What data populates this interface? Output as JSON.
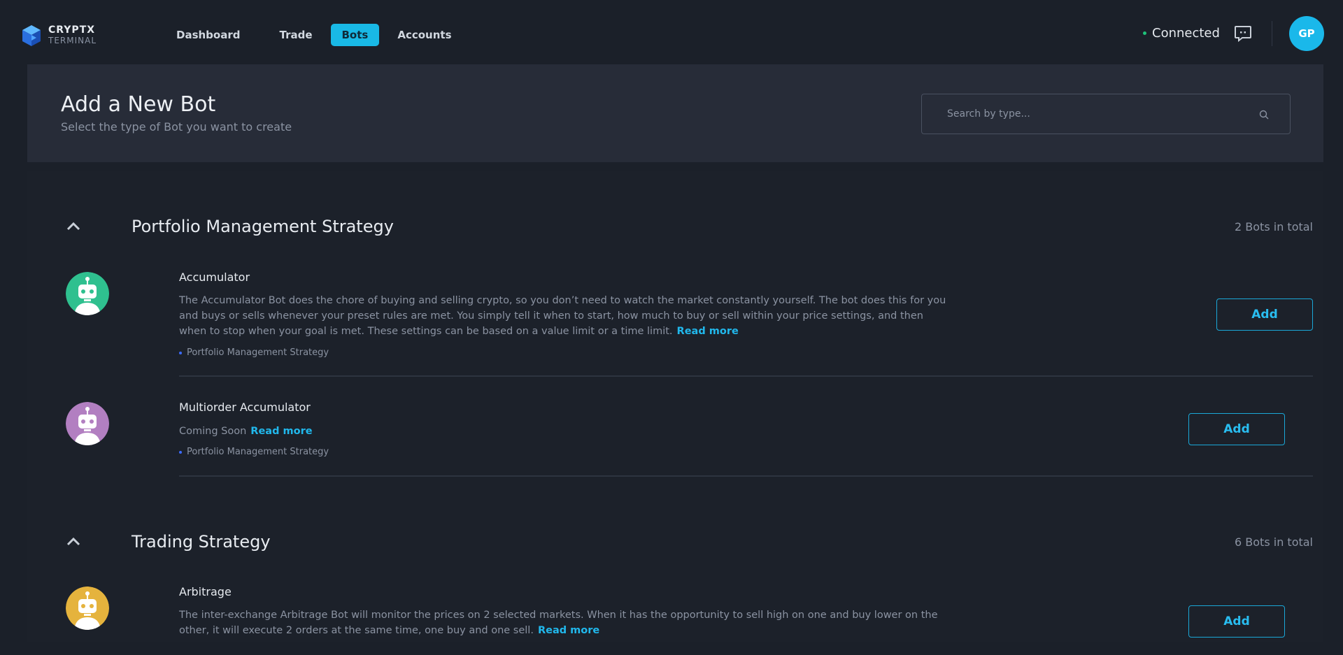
{
  "brand": {
    "line1": "CRYPTX",
    "line2": "TERMINAL"
  },
  "nav": {
    "items": [
      {
        "label": "Dashboard"
      },
      {
        "label": "Trade"
      },
      {
        "label": "Bots"
      },
      {
        "label": "Accounts"
      }
    ],
    "active": "Bots"
  },
  "status": {
    "connected_label": "Connected"
  },
  "user": {
    "initials": "GP"
  },
  "header": {
    "title": "Add a New Bot",
    "subtitle": "Select the type of Bot you want to create",
    "search_placeholder": "Search by type..."
  },
  "sections": [
    {
      "title": "Portfolio Management Strategy",
      "count": "2 Bots in total",
      "bots": [
        {
          "name": "Accumulator",
          "description": "The Accumulator Bot does the chore of buying and selling crypto, so you don’t need to watch the market constantly yourself. The bot does this for you and buys or sells whenever your preset rules are met. You simply tell it when to start, how much to buy or sell within your price settings, and then when to stop when your goal is met. These settings can be based on a value limit or a time limit.",
          "read_more": "Read more",
          "tag": "Portfolio Management Strategy",
          "add_label": "Add",
          "color": "#2fc08f"
        },
        {
          "name": "Multiorder Accumulator",
          "description": "Coming Soon",
          "read_more": "Read more",
          "tag": "Portfolio Management Strategy",
          "add_label": "Add",
          "color": "#b27fc1"
        }
      ]
    },
    {
      "title": "Trading Strategy",
      "count": "6 Bots in total",
      "bots": [
        {
          "name": "Arbitrage",
          "description": "The inter-exchange Arbitrage Bot will monitor the prices on 2 selected markets. When it has the opportunity to sell high on one and buy lower on the other, it will execute 2 orders at the same time, one buy and one sell.",
          "read_more": "Read more",
          "add_label": "Add",
          "color": "#e5b33d"
        }
      ]
    }
  ],
  "colors": {
    "accent": "#19b9e6",
    "connected": "#1fc27a",
    "tag_dot": "#3c6bff"
  },
  "icons": {
    "logo": "cube-logo-icon",
    "chat": "chat-icon",
    "search": "search-icon",
    "collapse": "chevron-up-icon",
    "bot": "robot-icon"
  }
}
